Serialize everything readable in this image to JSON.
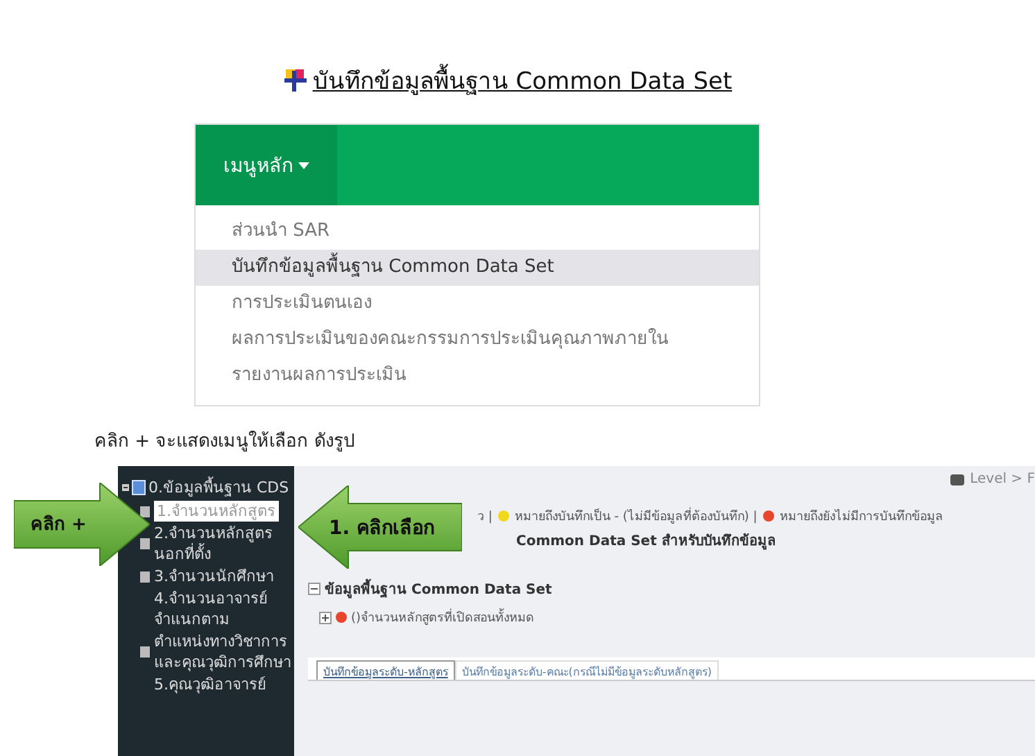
{
  "doc_title": {
    "text": "บันทึกข้อมูลพื้นฐาน Common Data Set"
  },
  "menu": {
    "button": "เมนูหลัก",
    "expanded": true,
    "items": [
      {
        "label": "ส่วนนำ SAR",
        "selected": false
      },
      {
        "label": "บันทึกข้อมูลพื้นฐาน Common Data Set",
        "selected": true
      },
      {
        "label": "การประเมินตนเอง",
        "selected": false
      },
      {
        "label": "ผลการประเมินของคณะกรรมการประเมินคุณภาพภายใน",
        "selected": false
      },
      {
        "label": "รายงานผลการประเมิน",
        "selected": false
      }
    ]
  },
  "caption": "คลิก + จะแสดงเมนูให้เลือก ดังรูป",
  "screenshot": {
    "tree": {
      "label": "0.ข้อมูลพื้นฐาน CDS",
      "expanded": true,
      "children": [
        {
          "label": "1.จำนวนหลักสูตร",
          "selected": true,
          "kind": "doc"
        },
        {
          "label": "2.จำนวนหลักสูตรนอกที่ตั้ง",
          "selected": false,
          "kind": "doc"
        },
        {
          "label": "3.จำนวนนักศึกษา",
          "selected": false,
          "kind": "doc"
        },
        {
          "label": "4.จำนวนอาจารย์จำแนกตาม",
          "selected": false,
          "kind": "text"
        },
        {
          "label": "ตำแหน่งทางวิชาการและคุณวุฒิการศึกษา",
          "selected": false,
          "kind": "doc"
        },
        {
          "label": "5.คุณวุฒิอาจารย์",
          "selected": false,
          "kind": "text"
        }
      ]
    },
    "breadcrumb": "Level > F",
    "legend": [
      {
        "text": "ว |"
      },
      {
        "text": "หมายถึงบันทึกเป็น - (ไม่มีข้อมูลที่ต้องบันทึก) |",
        "color": "#f2d81c"
      },
      {
        "text": "หมายถึงยังไม่มีการบันทึกข้อมูล",
        "color": "#e8452c"
      }
    ],
    "subtitle": "Common Data Set สำหรับบันทึกข้อมูล",
    "section": {
      "label": "ข้อมูลพื้นฐาน Common Data Set",
      "expanded": true,
      "rows": [
        {
          "label": "()จำนวนหลักสูตรที่เปิดสอนทั้งหมด",
          "expanded": false,
          "color": "#e8452c"
        }
      ]
    },
    "tabs": [
      {
        "label": "บันทึกข้อมูลระดับ-หลักสูตร",
        "selected": true
      },
      {
        "label": "บันทึกข้อมูลระดับ-คณะ(กรณีไม่มีข้อมูลระดับหลักสูตร)",
        "selected": false
      }
    ]
  },
  "callouts": [
    {
      "text": "คลิก +",
      "kind": "rightward"
    },
    {
      "text": "1. คลิกเลือก",
      "kind": "leftward"
    }
  ]
}
